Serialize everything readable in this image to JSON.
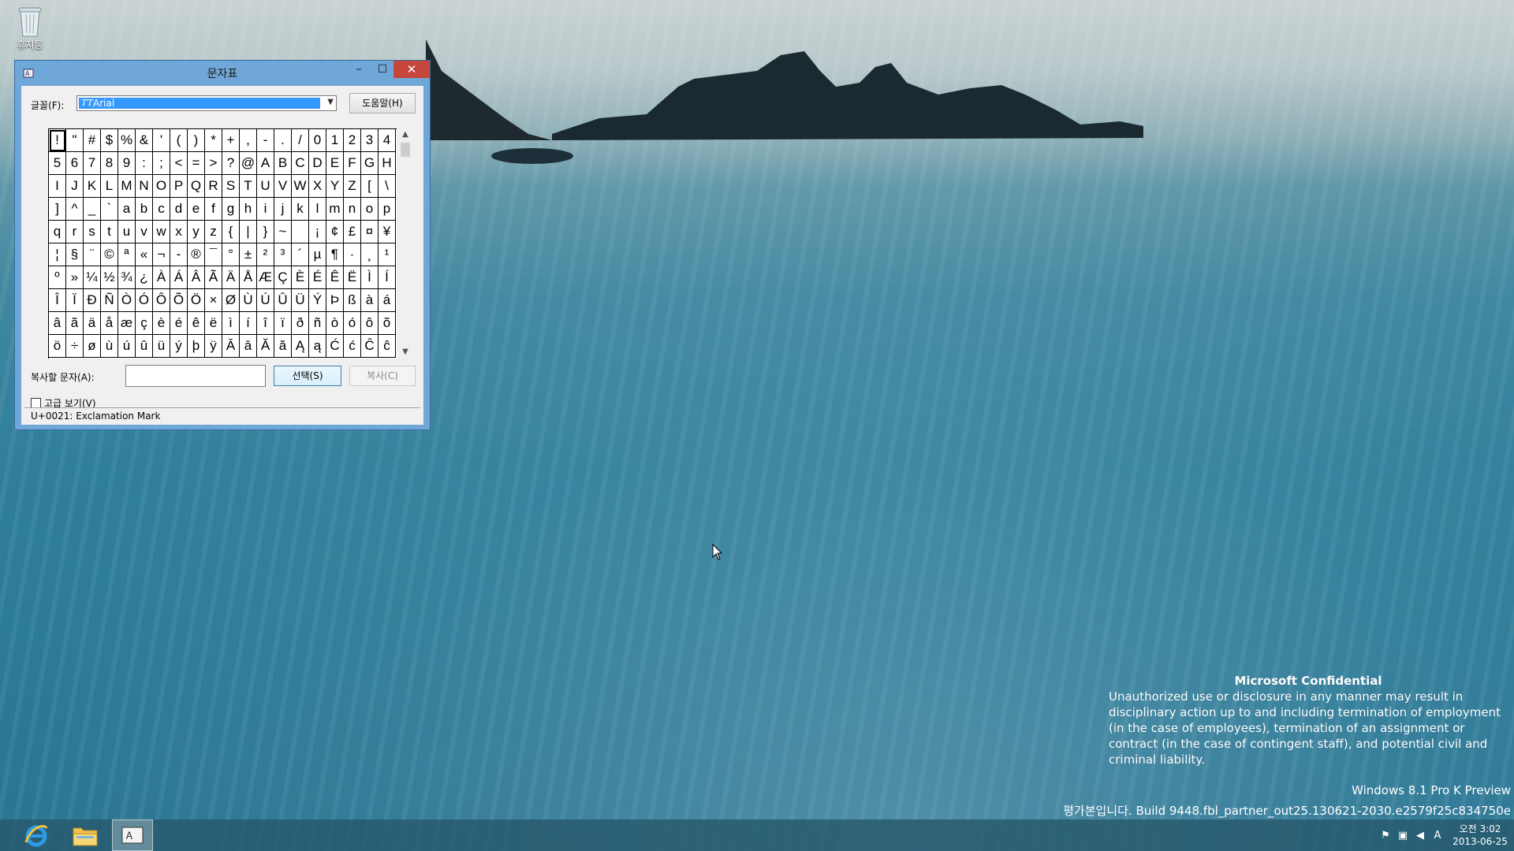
{
  "desktop": {
    "recycle_bin_label": "휴지통"
  },
  "window": {
    "title": "문자표",
    "minimize_glyph": "–",
    "maximize_glyph": "☐",
    "close_glyph": "✕",
    "font_label": "글꼴(F):",
    "font_value": "Arial",
    "font_type_badge": "TT",
    "help_button": "도움말(H)",
    "characters": [
      "!",
      "\"",
      "#",
      "$",
      "%",
      "&",
      "'",
      "(",
      ")",
      "*",
      "+",
      ",",
      "-",
      ".",
      "/",
      "0",
      "1",
      "2",
      "3",
      "4",
      "5",
      "6",
      "7",
      "8",
      "9",
      ":",
      ";",
      "<",
      "=",
      ">",
      "?",
      "@",
      "A",
      "B",
      "C",
      "D",
      "E",
      "F",
      "G",
      "H",
      "I",
      "J",
      "K",
      "L",
      "M",
      "N",
      "O",
      "P",
      "Q",
      "R",
      "S",
      "T",
      "U",
      "V",
      "W",
      "X",
      "Y",
      "Z",
      "[",
      "\\",
      "]",
      "^",
      "_",
      "`",
      "a",
      "b",
      "c",
      "d",
      "e",
      "f",
      "g",
      "h",
      "i",
      "j",
      "k",
      "l",
      "m",
      "n",
      "o",
      "p",
      "q",
      "r",
      "s",
      "t",
      "u",
      "v",
      "w",
      "x",
      "y",
      "z",
      "{",
      "|",
      "}",
      "~",
      " ",
      "¡",
      "¢",
      "£",
      "¤",
      "¥",
      "¦",
      "§",
      "¨",
      "©",
      "ª",
      "«",
      "¬",
      "-",
      "®",
      "¯",
      "°",
      "±",
      "²",
      "³",
      "´",
      "µ",
      "¶",
      "·",
      "¸",
      "¹",
      "º",
      "»",
      "¼",
      "½",
      "¾",
      "¿",
      "À",
      "Á",
      "Â",
      "Ã",
      "Ä",
      "Å",
      "Æ",
      "Ç",
      "È",
      "É",
      "Ê",
      "Ë",
      "Ì",
      "Í",
      "Î",
      "Ï",
      "Ð",
      "Ñ",
      "Ò",
      "Ó",
      "Ô",
      "Õ",
      "Ö",
      "×",
      "Ø",
      "Ù",
      "Ú",
      "Û",
      "Ü",
      "Ý",
      "Þ",
      "ß",
      "à",
      "á",
      "â",
      "ã",
      "ä",
      "å",
      "æ",
      "ç",
      "è",
      "é",
      "ê",
      "ë",
      "ì",
      "í",
      "î",
      "ï",
      "ð",
      "ñ",
      "ò",
      "ó",
      "ô",
      "õ",
      "ö",
      "÷",
      "ø",
      "ù",
      "ú",
      "û",
      "ü",
      "ý",
      "þ",
      "ÿ",
      "Ā",
      "ā",
      "Ă",
      "ă",
      "Ą",
      "ą",
      "Ć",
      "ć",
      "Ĉ",
      "ĉ"
    ],
    "selected_index": 0,
    "copy_label": "복사할 문자(A):",
    "copy_value": "",
    "select_button": "선택(S)",
    "copy_button": "복사(C)",
    "advanced_label": "고급 보기(V)",
    "advanced_checked": false,
    "status": "U+0021: Exclamation Mark"
  },
  "watermark": {
    "title": "Microsoft Confidential",
    "text": "Unauthorized use or disclosure in any manner may result in disciplinary action up to and including termination of employment (in the case of employees), termination of an assignment or contract (in the case of contingent staff), and potential civil and criminal liability.",
    "edition": "Windows 8.1 Pro K Preview",
    "build": "평가본입니다. Build 9448.fbl_partner_out25.130621-2030.e2579f25c834750e"
  },
  "taskbar": {
    "items": [
      {
        "icon": "internet-explorer-icon"
      },
      {
        "icon": "file-explorer-icon"
      },
      {
        "icon": "character-map-icon",
        "active": true
      }
    ],
    "tray": {
      "ime_indicator": "A",
      "time": "오전 3:02",
      "date": "2013-06-25"
    }
  }
}
